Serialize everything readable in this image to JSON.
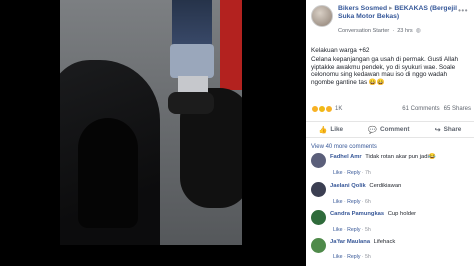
{
  "post": {
    "author": "Bikers Sosmed",
    "arrow": "▸",
    "group": "BEKAKAS (Bergejil Suka Motor Bekas)",
    "badge": "Conversation Starter",
    "time": "23 hrs",
    "caption_lines": [
      "Kelakuan warga +62",
      "Celana kepanjangan ga usah di permak. Gusti Allah yiptakke awakmu pendek, yo di syukuri wae. Soale celonomu sing kedawan mau iso di nggo wadah ngombe gantine tas 😄😄"
    ],
    "reaction_count": "1K",
    "comments_count": "61 Comments",
    "shares_count": "65 Shares"
  },
  "actions": {
    "like": "Like",
    "comment": "Comment",
    "share": "Share"
  },
  "view_more": "View 40 more comments",
  "comments": [
    {
      "name": "Fadhel Amr",
      "text": "Tidak rotan akar pun jadi😂",
      "like": "Like",
      "reply": "Reply",
      "time": "7h",
      "avatar_color": "#5b5f7a"
    },
    {
      "name": "Jaelani Qolik",
      "text": "Cerdikiawan",
      "like": "Like",
      "reply": "Reply",
      "time": "6h",
      "avatar_color": "#3b3f52"
    },
    {
      "name": "Candra Pamungkas",
      "text": "Cup holder",
      "like": "Like",
      "reply": "Reply",
      "time": "5h",
      "avatar_color": "#2f6b3b"
    },
    {
      "name": "Ja'far Maulana",
      "text": "Lifehack",
      "like": "Like",
      "reply": "Reply",
      "time": "5h",
      "avatar_color": "#4f8a4a"
    }
  ]
}
